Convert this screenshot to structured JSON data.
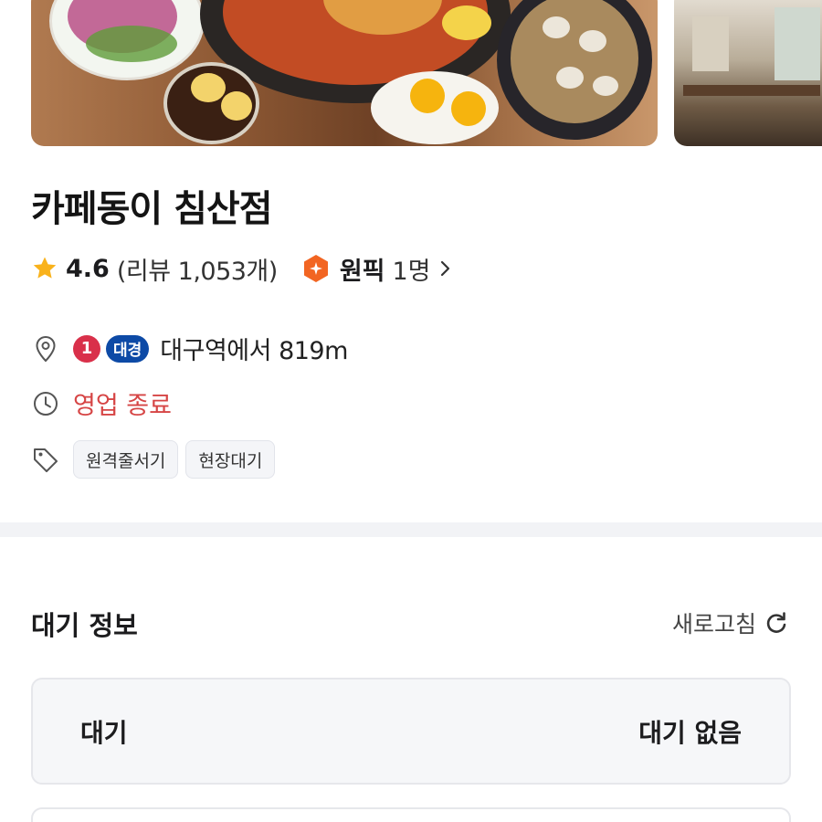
{
  "store": {
    "name": "카페동이 침산점",
    "rating": "4.6",
    "review_count": "(리뷰 1,053개)",
    "pick_label": "원픽",
    "pick_count": "1명"
  },
  "location": {
    "line_number": "1",
    "line_name": "대경",
    "distance_text": "대구역에서 819m"
  },
  "hours": {
    "status": "영업 종료"
  },
  "tags": [
    "원격줄서기",
    "현장대기"
  ],
  "wait_section": {
    "title": "대기 정보",
    "refresh_label": "새로고침",
    "row_label": "대기",
    "row_value": "대기 없음"
  },
  "colors": {
    "star": "#f9b21b",
    "pick_badge": "#f26522",
    "closed_text": "#d64545",
    "line1": "#d9304a",
    "line_daegyeong": "#0d4aa6"
  },
  "icons": {
    "location": "map-pin-icon",
    "hours": "clock-icon",
    "tags": "tag-icon",
    "refresh": "refresh-icon",
    "rating": "star-icon",
    "pick": "pick-badge-icon"
  }
}
